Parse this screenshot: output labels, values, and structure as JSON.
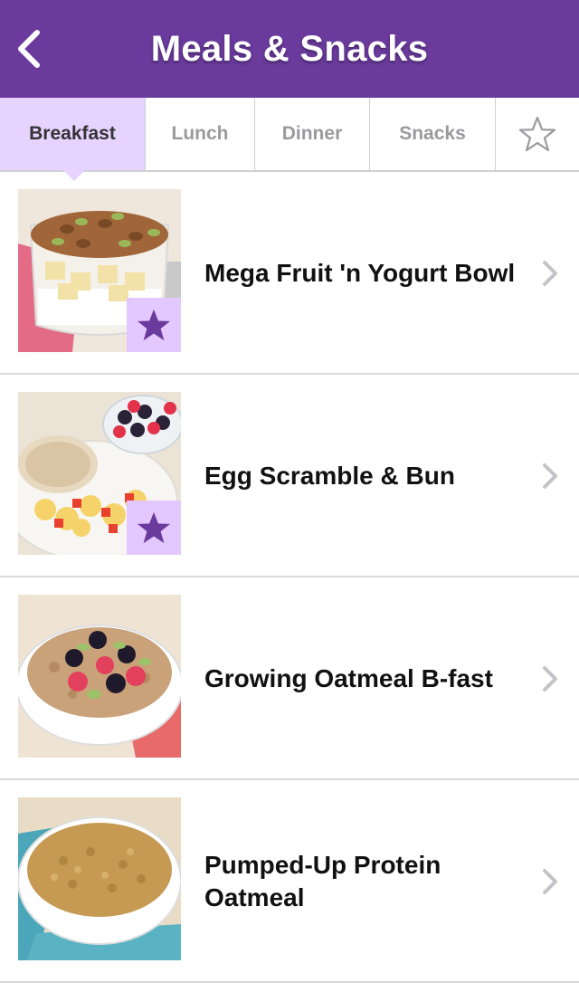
{
  "header": {
    "title": "Meals & Snacks",
    "back_icon": "chevron-left-icon",
    "background_color": "#6a3a9c"
  },
  "tabs": [
    {
      "label": "Breakfast",
      "active": true
    },
    {
      "label": "Lunch",
      "active": false
    },
    {
      "label": "Dinner",
      "active": false
    },
    {
      "label": "Snacks",
      "active": false
    },
    {
      "icon": "star-outline-icon",
      "active": false
    }
  ],
  "meals": [
    {
      "title": "Mega Fruit 'n Yogurt Bowl",
      "favorite": true
    },
    {
      "title": "Egg Scramble & Bun",
      "favorite": true
    },
    {
      "title": "Growing Oatmeal B-fast",
      "favorite": false
    },
    {
      "title": "Pumped-Up Protein Oatmeal",
      "favorite": false
    }
  ],
  "colors": {
    "accent": "#6a3a9c",
    "active_tab": "#e6d3ff",
    "favorite_badge": "#e3c8ff",
    "star": "#6a3a9c"
  }
}
